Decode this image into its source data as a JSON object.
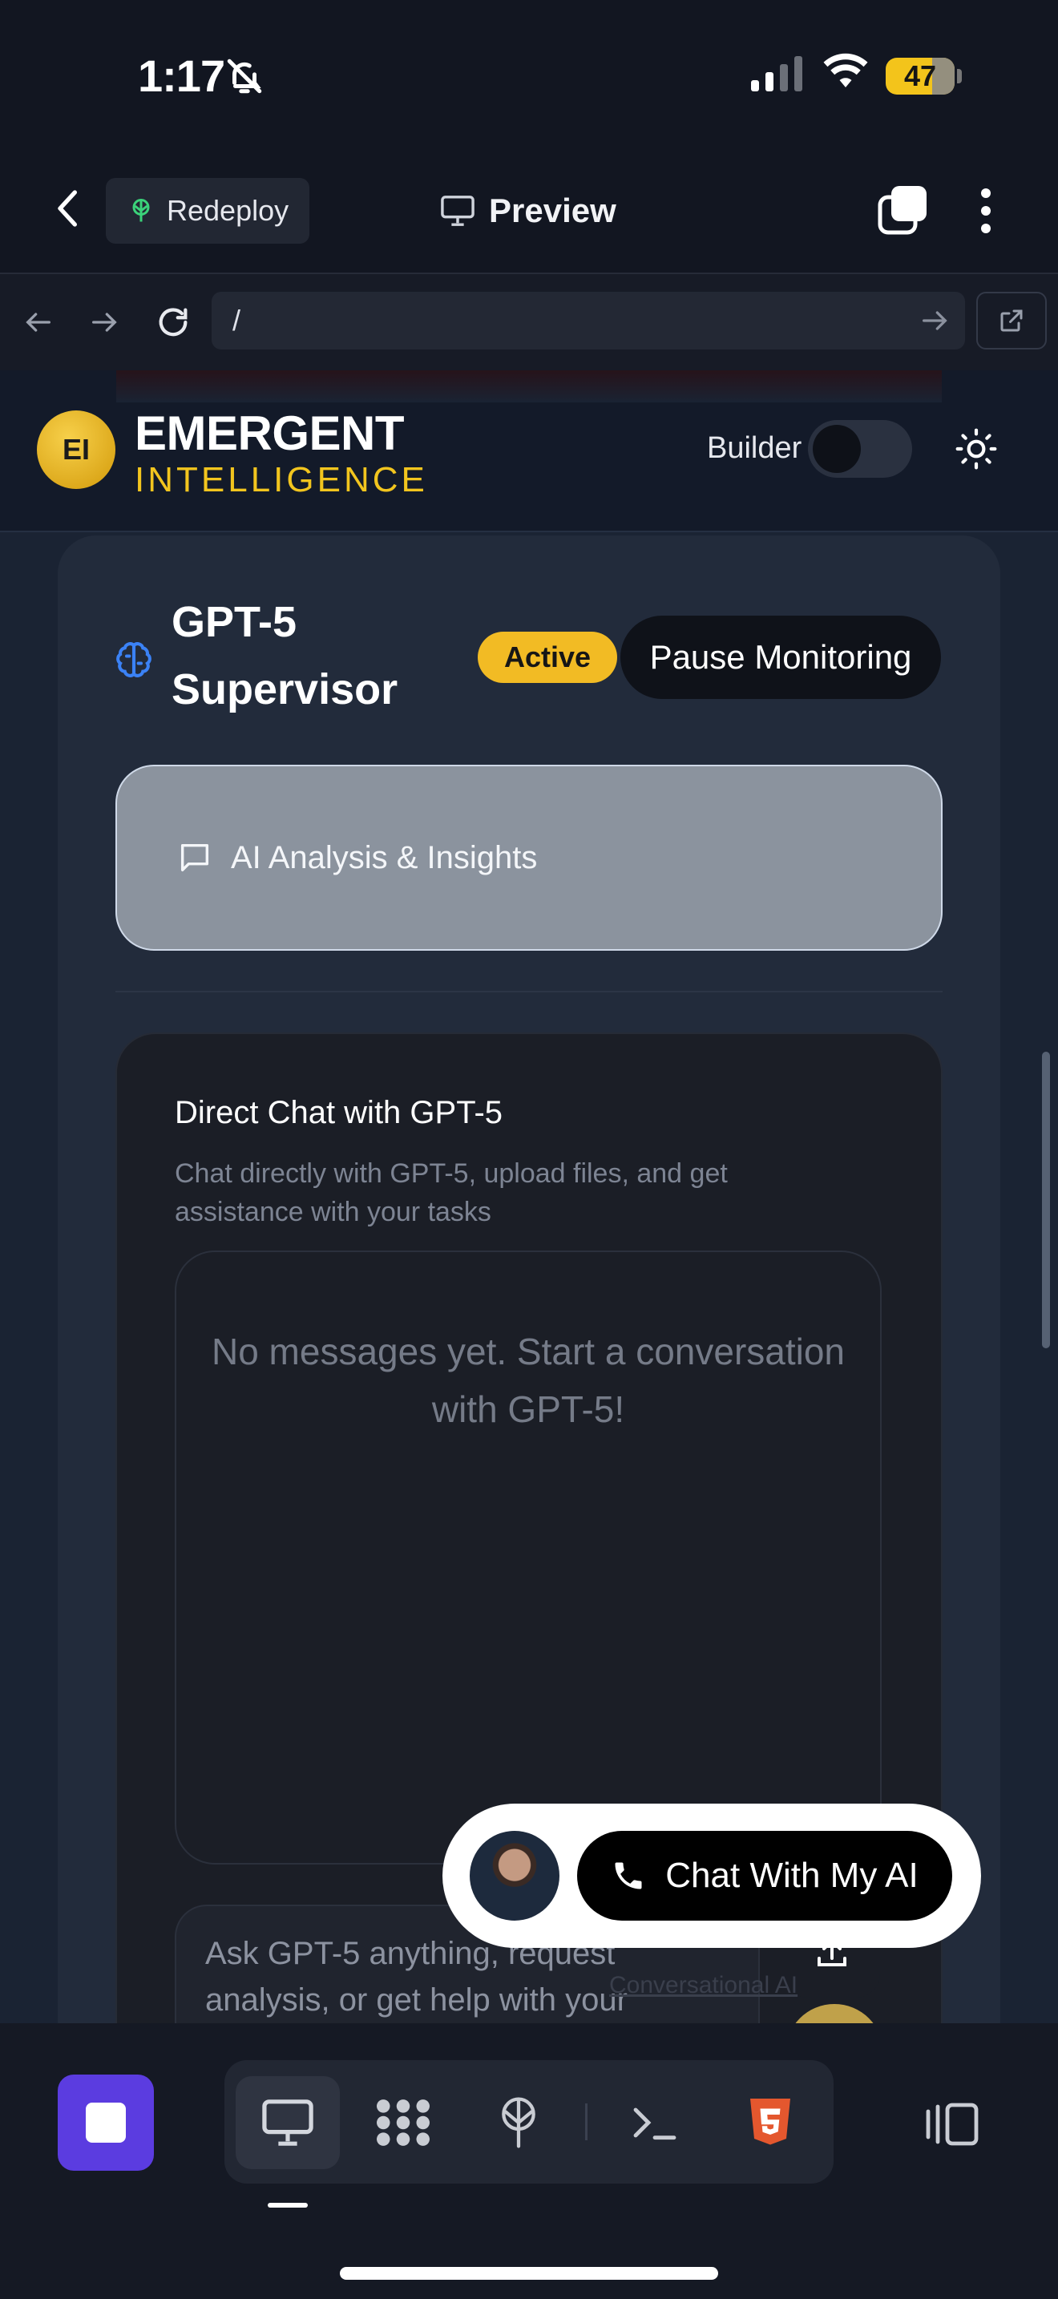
{
  "status_bar": {
    "time": "1:17",
    "battery": "47"
  },
  "app_header": {
    "redeploy_label": "Redeploy",
    "preview_label": "Preview"
  },
  "browser": {
    "url": "/"
  },
  "site": {
    "logo_initials": "EI",
    "brand_line1": "EMERGENT",
    "brand_line2": "INTELLIGENCE",
    "builder_label": "Builder",
    "builder_toggle_on": false
  },
  "supervisor": {
    "title_line1": "GPT-5",
    "title_line2": "Supervisor",
    "status_badge": "Active",
    "pause_button": "Pause Monitoring",
    "analysis_tab": "AI Analysis & Insights"
  },
  "chat": {
    "title": "Direct Chat with GPT-5",
    "description": "Chat directly with GPT-5, upload files, and get assistance with your tasks",
    "empty_message": "No messages yet. Start a conversation with GPT-5!",
    "input_placeholder": "Ask GPT-5 anything, request analysis, or get help with your",
    "powered_by": "Conversational AI"
  },
  "widget": {
    "button_label": "Chat With My AI"
  },
  "colors": {
    "accent_yellow": "#f2bb24",
    "stop_purple": "#5b3ce0",
    "brand_yellow": "#f2c51e"
  }
}
